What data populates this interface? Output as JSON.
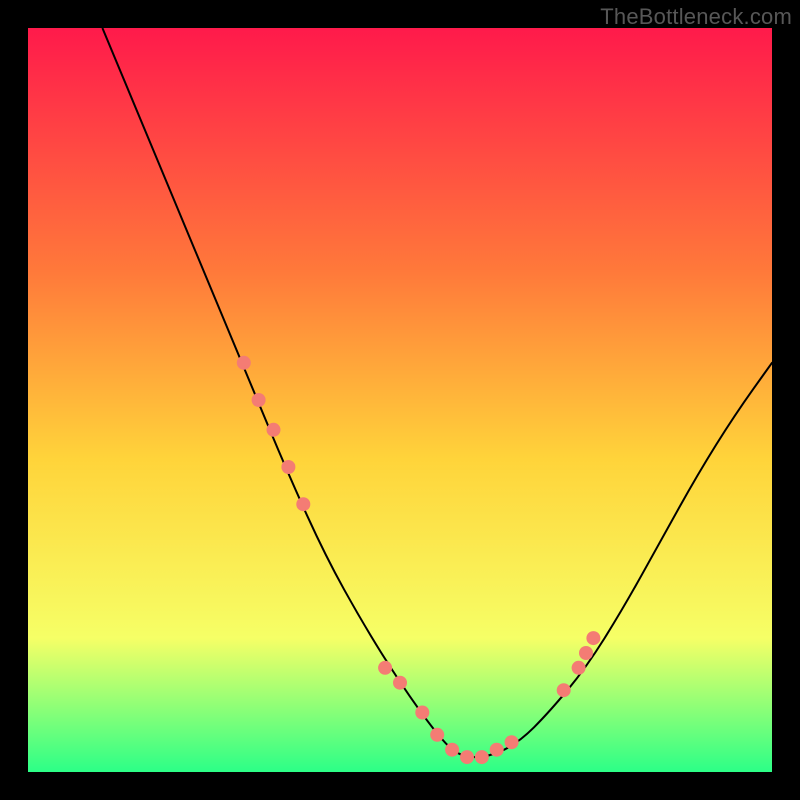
{
  "watermark": "TheBottleneck.com",
  "chart_data": {
    "type": "line",
    "title": "",
    "xlabel": "",
    "ylabel": "",
    "xlim": [
      0,
      100
    ],
    "ylim": [
      0,
      100
    ],
    "grid": false,
    "background_gradient": {
      "top": "#ff1a4b",
      "mid_upper": "#ff7a3a",
      "mid": "#ffd43a",
      "mid_lower": "#f6ff66",
      "bottom": "#2cff87"
    },
    "series": [
      {
        "name": "bottleneck-curve",
        "x": [
          10,
          15,
          20,
          25,
          30,
          35,
          40,
          45,
          50,
          55,
          58,
          62,
          66,
          70,
          75,
          80,
          85,
          90,
          95,
          100
        ],
        "y": [
          100,
          88,
          76,
          64,
          52,
          40,
          29,
          20,
          12,
          5,
          2,
          2,
          4,
          8,
          14,
          22,
          31,
          40,
          48,
          55
        ],
        "stroke": "#000000",
        "stroke_width": 2
      }
    ],
    "markers": {
      "name": "highlight-dots",
      "color": "#f47c74",
      "radius": 7,
      "points": [
        {
          "x": 29,
          "y": 55
        },
        {
          "x": 31,
          "y": 50
        },
        {
          "x": 33,
          "y": 46
        },
        {
          "x": 35,
          "y": 41
        },
        {
          "x": 37,
          "y": 36
        },
        {
          "x": 48,
          "y": 14
        },
        {
          "x": 50,
          "y": 12
        },
        {
          "x": 53,
          "y": 8
        },
        {
          "x": 55,
          "y": 5
        },
        {
          "x": 57,
          "y": 3
        },
        {
          "x": 59,
          "y": 2
        },
        {
          "x": 61,
          "y": 2
        },
        {
          "x": 63,
          "y": 3
        },
        {
          "x": 65,
          "y": 4
        },
        {
          "x": 72,
          "y": 11
        },
        {
          "x": 74,
          "y": 14
        },
        {
          "x": 75,
          "y": 16
        },
        {
          "x": 76,
          "y": 18
        }
      ]
    }
  }
}
